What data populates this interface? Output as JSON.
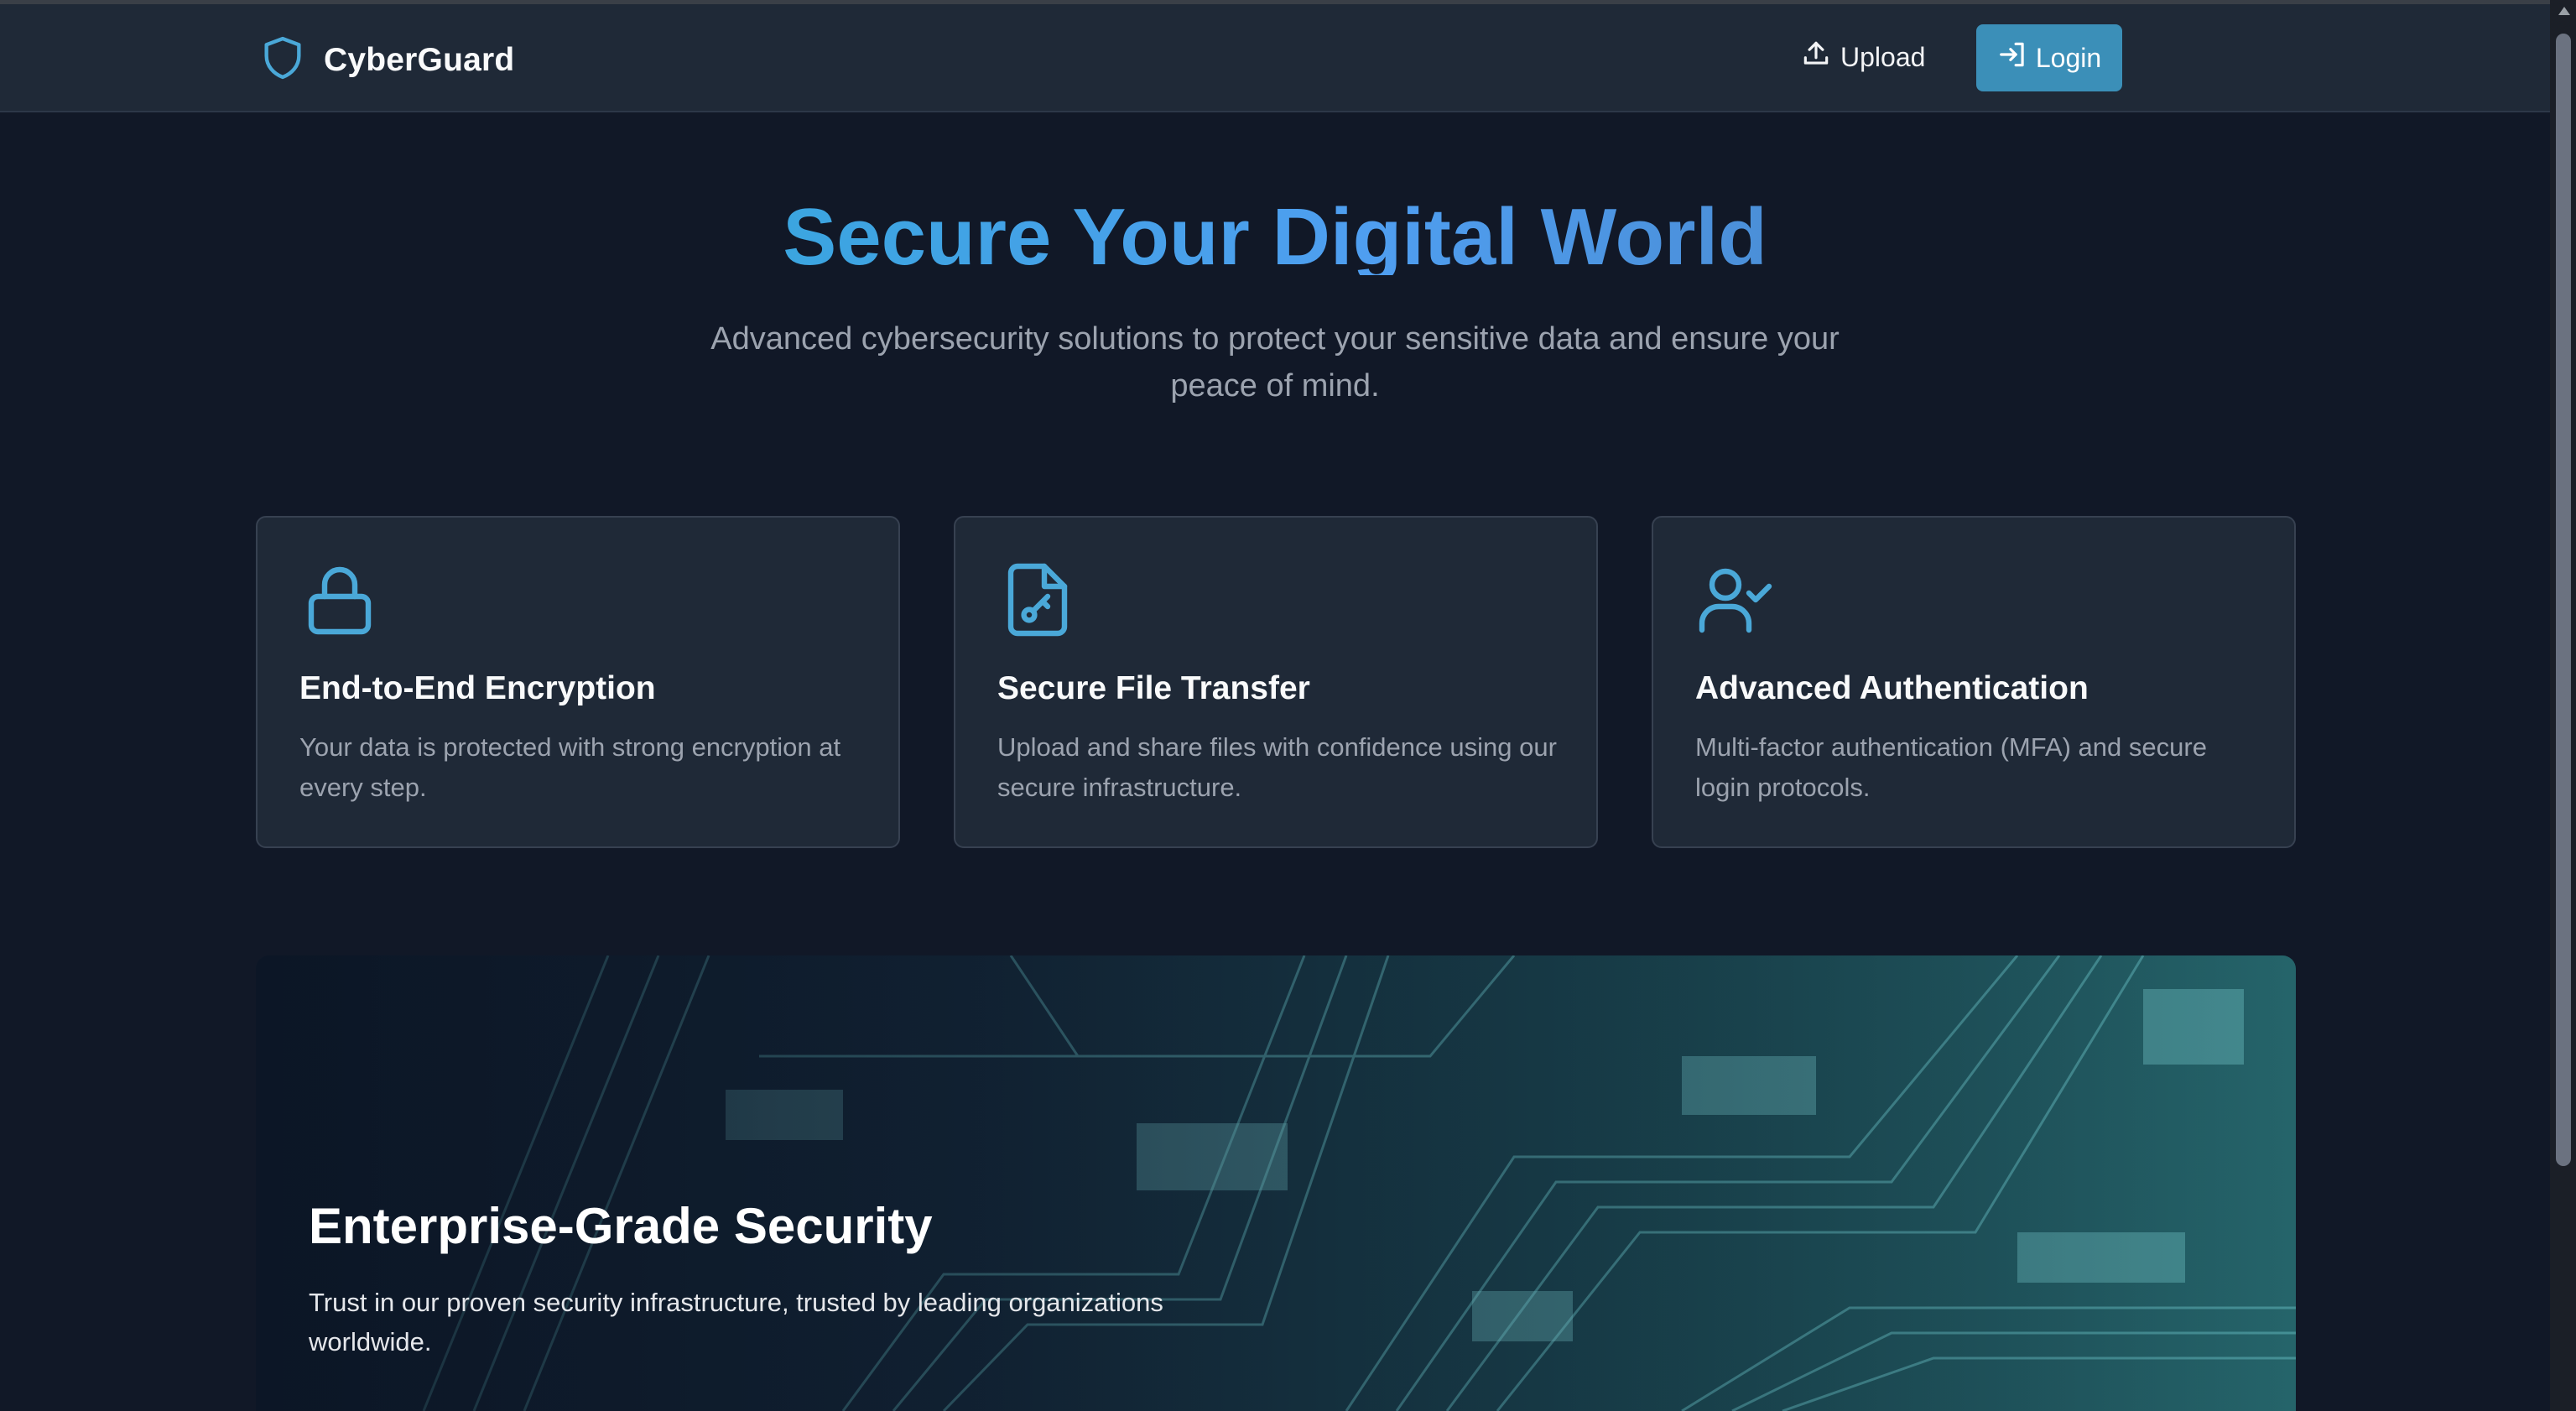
{
  "header": {
    "brand_name": "CyberGuard",
    "brand_icon": "shield-icon",
    "upload_label": "Upload",
    "login_label": "Login"
  },
  "hero": {
    "title": "Secure Your Digital World",
    "subtitle": "Advanced cybersecurity solutions to protect your sensitive data and ensure your peace of mind."
  },
  "features": [
    {
      "icon": "lock-icon",
      "title": "End-to-End Encryption",
      "description": "Your data is protected with strong encryption at every step."
    },
    {
      "icon": "file-key-icon",
      "title": "Secure File Transfer",
      "description": "Upload and share files with confidence using our secure infrastructure."
    },
    {
      "icon": "user-check-icon",
      "title": "Advanced Authentication",
      "description": "Multi-factor authentication (MFA) and secure login protocols."
    }
  ],
  "banner": {
    "title": "Enterprise-Grade Security",
    "description": "Trust in our proven security infrastructure, trusted by leading organizations worldwide."
  },
  "colors": {
    "background": "#111827",
    "navbar": "#1f2937",
    "card": "#1f2937",
    "accent": "#4aa8d8",
    "login_button": "#3b8fb8"
  }
}
